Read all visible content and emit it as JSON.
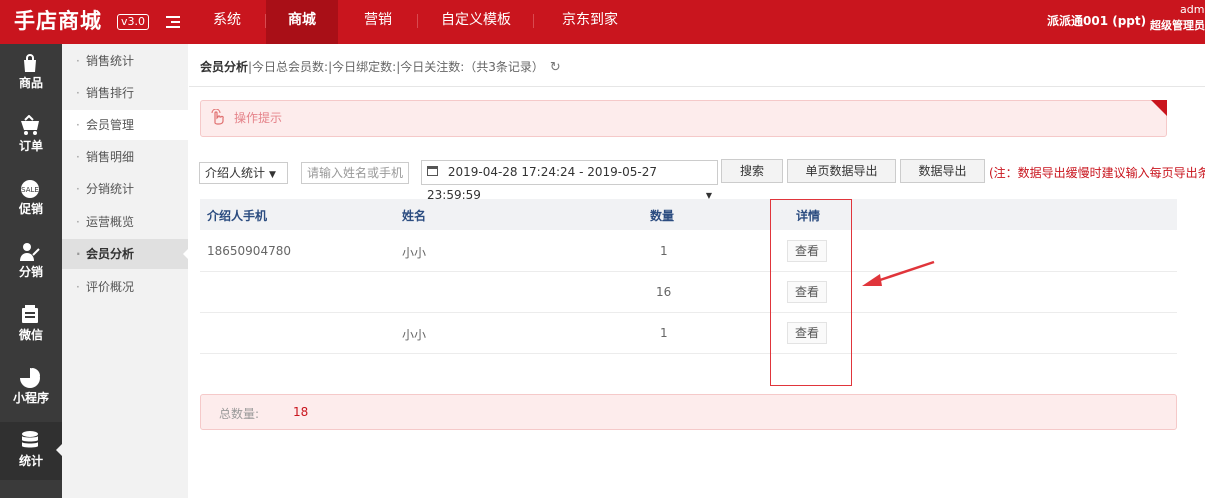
{
  "brand": {
    "logo": "手店商城",
    "version": "v3.0"
  },
  "nav": [
    {
      "label": "系统",
      "active": false
    },
    {
      "label": "商城",
      "active": true
    },
    {
      "label": "营销",
      "active": false
    },
    {
      "label": "自定义模板",
      "active": false
    },
    {
      "label": "京东到家",
      "active": false
    }
  ],
  "user": {
    "shop": "派派通001 (ppt)",
    "admin_name": "admi",
    "admin_role": "超级管理员"
  },
  "iconbar": [
    {
      "label": "商品",
      "icon": "bag-icon"
    },
    {
      "label": "订单",
      "icon": "cart-icon"
    },
    {
      "label": "促销",
      "icon": "sale-icon"
    },
    {
      "label": "分销",
      "icon": "distribution-icon"
    },
    {
      "label": "微信",
      "icon": "wechat-icon"
    },
    {
      "label": "小程序",
      "icon": "pie-icon"
    },
    {
      "label": "统计",
      "icon": "database-icon"
    }
  ],
  "submenu": [
    {
      "label": "销售统计"
    },
    {
      "label": "销售排行"
    },
    {
      "label": "会员管理"
    },
    {
      "label": "销售明细"
    },
    {
      "label": "分销统计"
    },
    {
      "label": "运营概览"
    },
    {
      "label": "会员分析"
    },
    {
      "label": "评价概况"
    }
  ],
  "breadcrumb": {
    "title": "会员分析",
    "rest": "|今日总会员数:|今日绑定数:|今日关注数:（共3条记录）"
  },
  "tip": {
    "text": "操作提示"
  },
  "filters": {
    "select_value": "介绍人统计",
    "search_placeholder": "请输入姓名或手机",
    "date_range": "2019-04-28 17:24:24 - 2019-05-27 23:59:59",
    "search_btn": "搜索",
    "export_page_btn": "单页数据导出",
    "export_btn": "数据导出",
    "note": "(注：数据导出缓慢时建议输入每页导出条"
  },
  "table": {
    "headers": [
      "介绍人手机",
      "姓名",
      "数量",
      "详情"
    ],
    "rows": [
      {
        "phone": "18650904780",
        "name": "小小",
        "count": "1",
        "action": "查看"
      },
      {
        "phone": "",
        "name": "",
        "count": "16",
        "action": "查看"
      },
      {
        "phone": "",
        "name": "小小",
        "count": "1",
        "action": "查看"
      }
    ]
  },
  "total": {
    "label": "总数量:",
    "value": "18"
  },
  "colors": {
    "brand": "#c9151e",
    "sidebar": "#3a3a3a",
    "tip_bg": "#fdecec"
  }
}
